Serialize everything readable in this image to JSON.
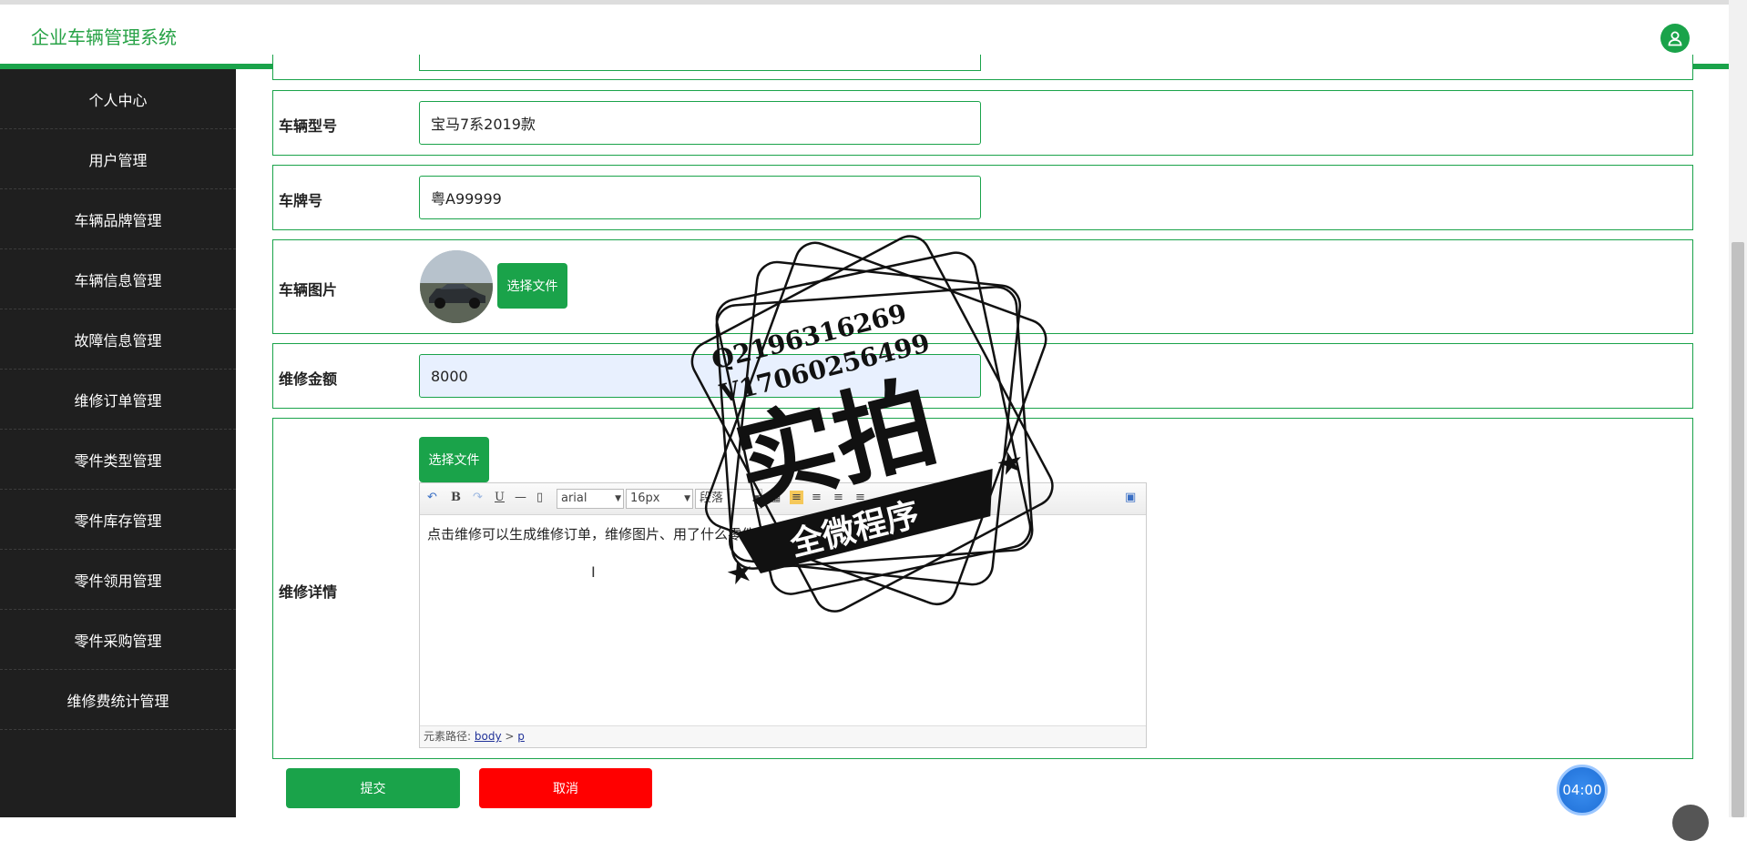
{
  "header": {
    "app_title": "企业车辆管理系统",
    "user_icon": "user-icon"
  },
  "sidebar": {
    "items": [
      {
        "label": "个人中心"
      },
      {
        "label": "用户管理"
      },
      {
        "label": "车辆品牌管理"
      },
      {
        "label": "车辆信息管理"
      },
      {
        "label": "故障信息管理"
      },
      {
        "label": "维修订单管理"
      },
      {
        "label": "零件类型管理"
      },
      {
        "label": "零件库存管理"
      },
      {
        "label": "零件领用管理"
      },
      {
        "label": "零件采购管理"
      },
      {
        "label": "维修费统计管理"
      }
    ]
  },
  "form": {
    "model": {
      "label": "车辆型号",
      "value": "宝马7系2019款"
    },
    "plate": {
      "label": "车牌号",
      "value": "粤A99999"
    },
    "image": {
      "label": "车辆图片",
      "choose_file": "选择文件"
    },
    "amount": {
      "label": "维修金额",
      "value": "8000"
    },
    "detail": {
      "label": "维修详情",
      "choose_file": "选择文件",
      "toolbar": {
        "font": "arial",
        "size": "16px",
        "paragraph": "段落"
      },
      "content": "点击维修可以生成维修订单，维修图片、用了什么零件等等可",
      "path_label": "元素路径:",
      "path_body": "body",
      "path_sep": ">",
      "path_p": "p"
    }
  },
  "actions": {
    "submit": "提交",
    "cancel": "取消"
  },
  "timer": "04:00",
  "watermark": {
    "line1": "Q2196316269",
    "line2": "V17060256499",
    "big": "实拍",
    "banner": "全微程序"
  },
  "colors": {
    "accent": "#1aa34a",
    "sidebar_bg": "#1f1f1f",
    "danger": "#ff0000",
    "amount_bg": "#e8f0fe"
  }
}
